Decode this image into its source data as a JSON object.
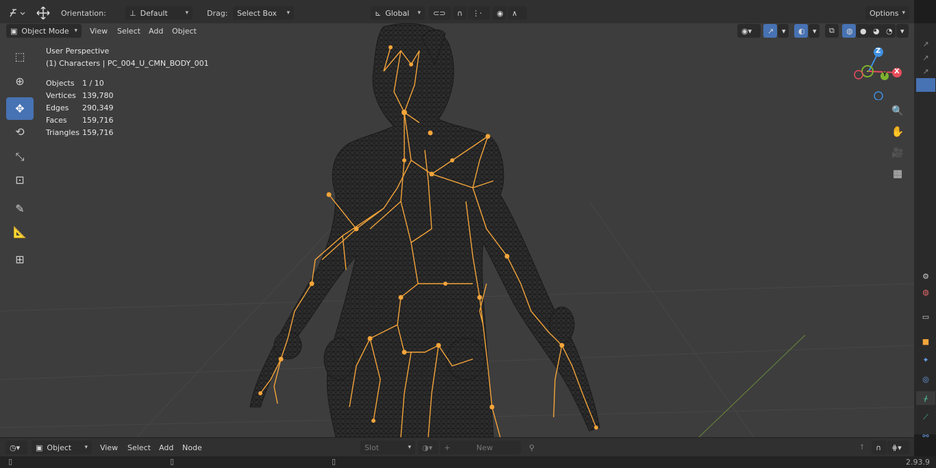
{
  "header": {
    "orientation_label": "Orientation:",
    "orientation_value": "Default",
    "drag_label": "Drag:",
    "drag_value": "Select Box",
    "transform_space": "Global",
    "options_label": "Options"
  },
  "viewport_header": {
    "mode": "Object Mode",
    "menus": [
      "View",
      "Select",
      "Add",
      "Object"
    ]
  },
  "overlay": {
    "perspective": "User Perspective",
    "collection": "(1) Characters | PC_004_U_CMN_BODY_001",
    "stats": [
      {
        "label": "Objects",
        "value": "1 / 10"
      },
      {
        "label": "Vertices",
        "value": "139,780"
      },
      {
        "label": "Edges",
        "value": "290,349"
      },
      {
        "label": "Faces",
        "value": "159,716"
      },
      {
        "label": "Triangles",
        "value": "159,716"
      }
    ]
  },
  "gizmo": {
    "x": "X",
    "y": "Y",
    "z": "Z"
  },
  "node_editor_header": {
    "type": "Object",
    "menus": [
      "View",
      "Select",
      "Add",
      "Node"
    ],
    "slot": "Slot",
    "new_label": "New"
  },
  "status": {
    "version": "2.93.9"
  },
  "colors": {
    "accent": "#4772b3",
    "armature": "#f5a53a",
    "x_axis": "#e84d5c",
    "y_axis": "#7fb32e",
    "z_axis": "#3f8fe0"
  }
}
